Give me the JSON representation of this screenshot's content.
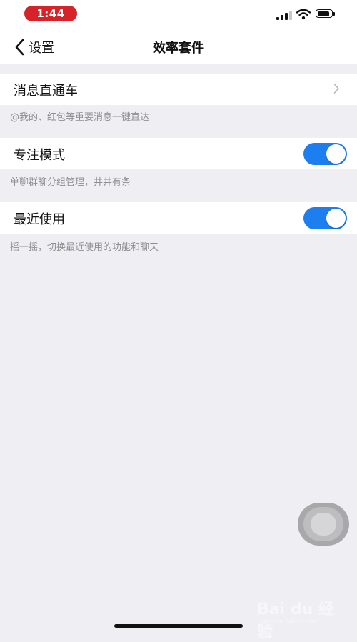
{
  "status_bar": {
    "time": "1:44"
  },
  "nav": {
    "back_label": "设置",
    "title": "效率套件"
  },
  "settings": [
    {
      "label": "消息直通车",
      "control": "chevron",
      "description": "@我的、红包等重要消息一键直达"
    },
    {
      "label": "专注模式",
      "control": "toggle",
      "enabled": true,
      "description": "单聊群聊分组管理，井井有条"
    },
    {
      "label": "最近使用",
      "control": "toggle",
      "enabled": true,
      "description": "摇一摇，切换最近使用的功能和聊天"
    }
  ],
  "watermark": {
    "text": "Bai du 经验",
    "url": "jingyan.baidu.com"
  },
  "colors": {
    "accent": "#1d7ef0",
    "time_pill": "#d6232a",
    "background": "#eeeef3"
  }
}
